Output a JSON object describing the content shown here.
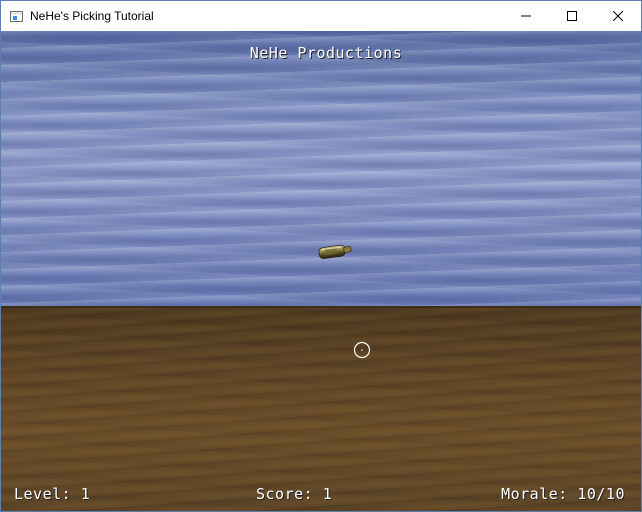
{
  "window": {
    "title": "NeHe's Picking Tutorial",
    "icon": "app-window-icon",
    "controls": [
      "minimize-icon",
      "maximize-icon",
      "close-icon"
    ]
  },
  "hud": {
    "title": "NeHe Productions",
    "level": "Level: 1",
    "score": "Score: 1",
    "morale": "Morale: 10/10"
  },
  "scene": {
    "sky_color": "#7f90c2",
    "ground_color": "#5f4526",
    "target": "bottle-target",
    "cursor": "crosshair-cursor"
  }
}
